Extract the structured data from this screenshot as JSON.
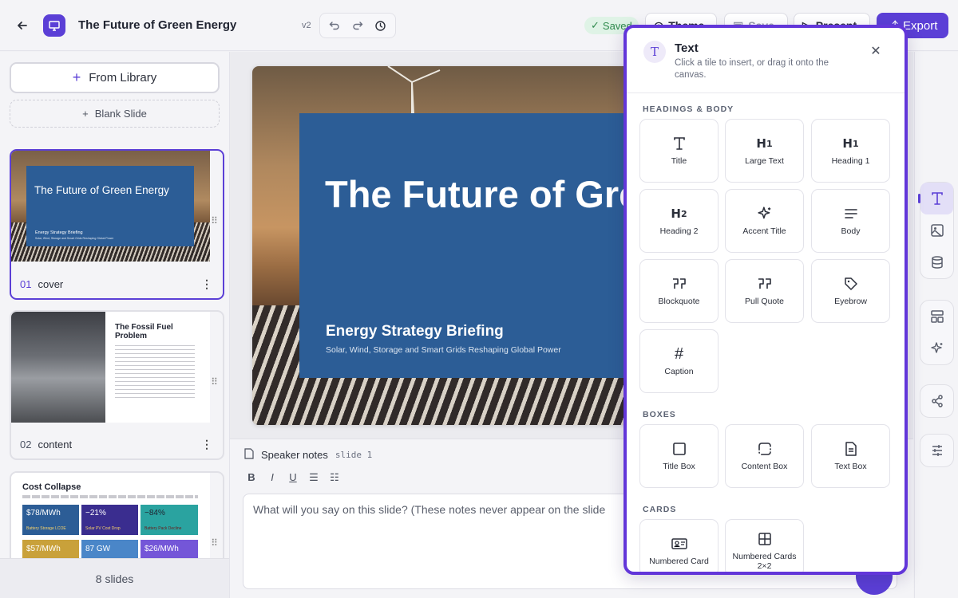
{
  "header": {
    "title": "The Future of Green Energy",
    "version": "v2",
    "saved": "Saved",
    "theme": "Theme",
    "save": "Save",
    "present": "Present",
    "export": "Export"
  },
  "sidebar": {
    "from_library": "From Library",
    "blank_slide": "Blank Slide",
    "slide_count": "8 slides",
    "thumbs": [
      {
        "num": "01",
        "name": "cover",
        "title": "The Future of Green Energy",
        "subtitle": "Energy Strategy Briefing",
        "tagline": "Solar, Wind, Storage and Smart Grids Reshaping Global Power"
      },
      {
        "num": "02",
        "name": "content",
        "title": "The Fossil Fuel Problem"
      },
      {
        "title": "Cost Collapse",
        "stats": [
          {
            "value": "$78/MWh",
            "label": "Battery Storage LCOE",
            "color": "#2c5d96"
          },
          {
            "value": "−21%",
            "label": "Solar PV Cost Drop",
            "color": "#3a2d8f"
          },
          {
            "value": "−84%",
            "label": "Battery Pack Decline",
            "color": "#2aa3a0"
          },
          {
            "value": "$57/MWh",
            "label": "",
            "color": "#c9a13a"
          },
          {
            "value": "87 GW",
            "label": "",
            "color": "#4a86c8"
          },
          {
            "value": "$26/MWh",
            "label": "",
            "color": "#7456d8"
          }
        ]
      }
    ]
  },
  "slide": {
    "title": "The Future of Gree",
    "subtitle": "Energy Strategy Briefing",
    "tagline": "Solar, Wind, Storage and Smart Grids Reshaping Global Power"
  },
  "notes": {
    "label": "Speaker notes",
    "slide_ref": "slide 1",
    "placeholder": "What will you say on this slide? (These notes never appear on the slide"
  },
  "insert_panel": {
    "title": "Text",
    "description": "Click a tile to insert, or drag it onto the canvas.",
    "sections": [
      {
        "label": "HEADINGS & BODY",
        "tiles": [
          {
            "label": "Title",
            "icon": "title-icon"
          },
          {
            "label": "Large Text",
            "icon": "heading-1-icon"
          },
          {
            "label": "Heading 1",
            "icon": "heading-1-icon"
          },
          {
            "label": "Heading 2",
            "icon": "heading-2-icon"
          },
          {
            "label": "Accent Title",
            "icon": "sparkle-icon"
          },
          {
            "label": "Body",
            "icon": "align-left-icon"
          },
          {
            "label": "Blockquote",
            "icon": "quote-icon"
          },
          {
            "label": "Pull Quote",
            "icon": "quote-icon"
          },
          {
            "label": "Eyebrow",
            "icon": "tag-icon"
          },
          {
            "label": "Caption",
            "icon": "hash-icon"
          }
        ]
      },
      {
        "label": "BOXES",
        "tiles": [
          {
            "label": "Title Box",
            "icon": "square-icon"
          },
          {
            "label": "Content Box",
            "icon": "dashed-square-icon"
          },
          {
            "label": "Text Box",
            "icon": "document-icon"
          }
        ]
      },
      {
        "label": "CARDS",
        "tiles": [
          {
            "label": "Numbered Card",
            "icon": "id-card-icon"
          },
          {
            "label": "Numbered Cards 2×2",
            "icon": "grid-icon"
          }
        ]
      }
    ]
  }
}
